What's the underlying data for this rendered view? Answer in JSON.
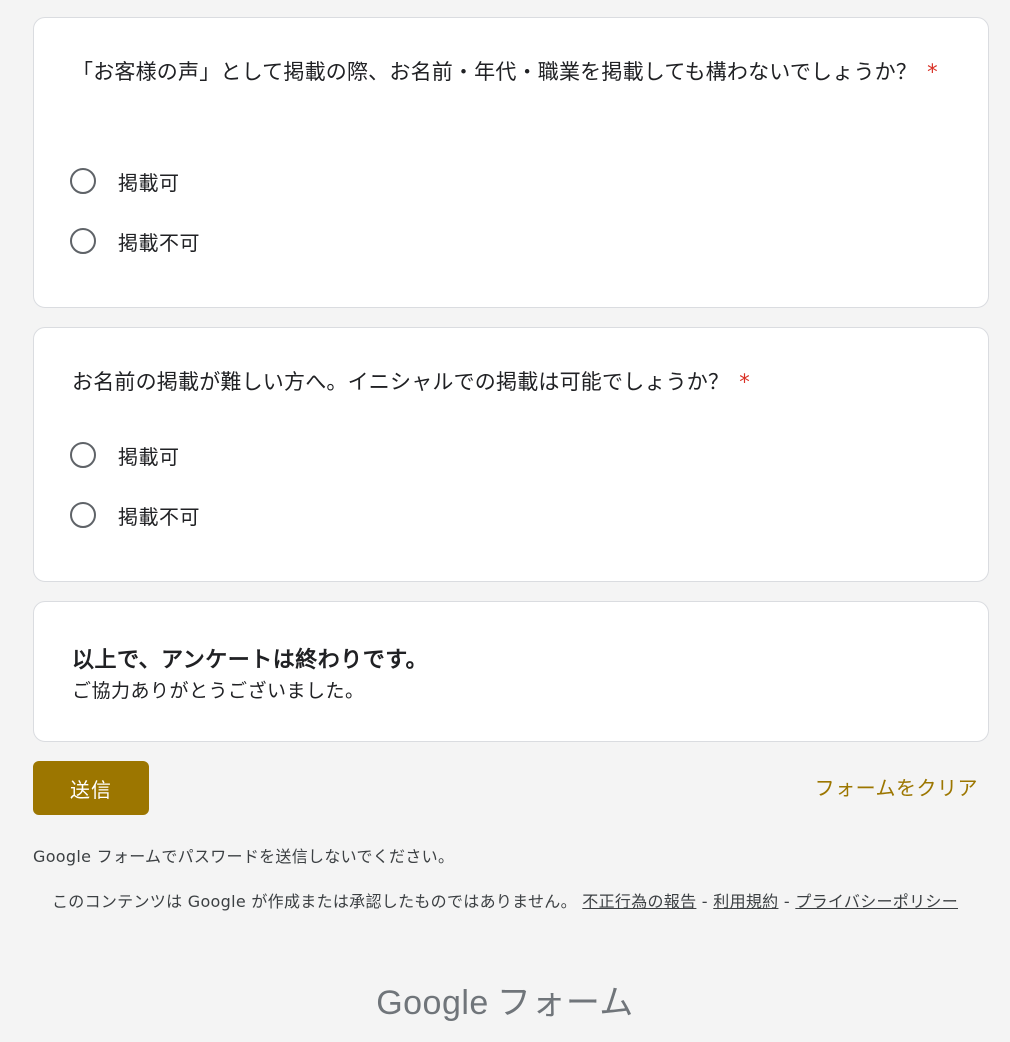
{
  "questions": [
    {
      "text": "「お客様の声」として掲載の際、お名前・年代・職業を掲載しても構わないでしょうか？",
      "required_mark": "*",
      "options": [
        {
          "label": "掲載可"
        },
        {
          "label": "掲載不可"
        }
      ]
    },
    {
      "text": "お名前の掲載が難しい方へ。イニシャルでの掲載は可能でしょうか？",
      "required_mark": "*",
      "options": [
        {
          "label": "掲載可"
        },
        {
          "label": "掲載不可"
        }
      ]
    }
  ],
  "end_section": {
    "title": "以上で、アンケートは終わりです。",
    "subtitle": "ご協力ありがとうございました。"
  },
  "actions": {
    "submit_label": "送信",
    "clear_label": "フォームをクリア"
  },
  "footer": {
    "password_note": "Google フォームでパスワードを送信しないでください。",
    "disclaimer": "このコンテンツは Google が作成または承認したものではありません。",
    "report_link": "不正行為の報告",
    "terms_link": "利用規約",
    "privacy_link": "プライバシーポリシー",
    "separator": "-",
    "logo_google": "Google",
    "logo_forms": "フォーム"
  },
  "colors": {
    "accent": "#9c7600",
    "required": "#d93025",
    "background": "#f4f4f4"
  }
}
